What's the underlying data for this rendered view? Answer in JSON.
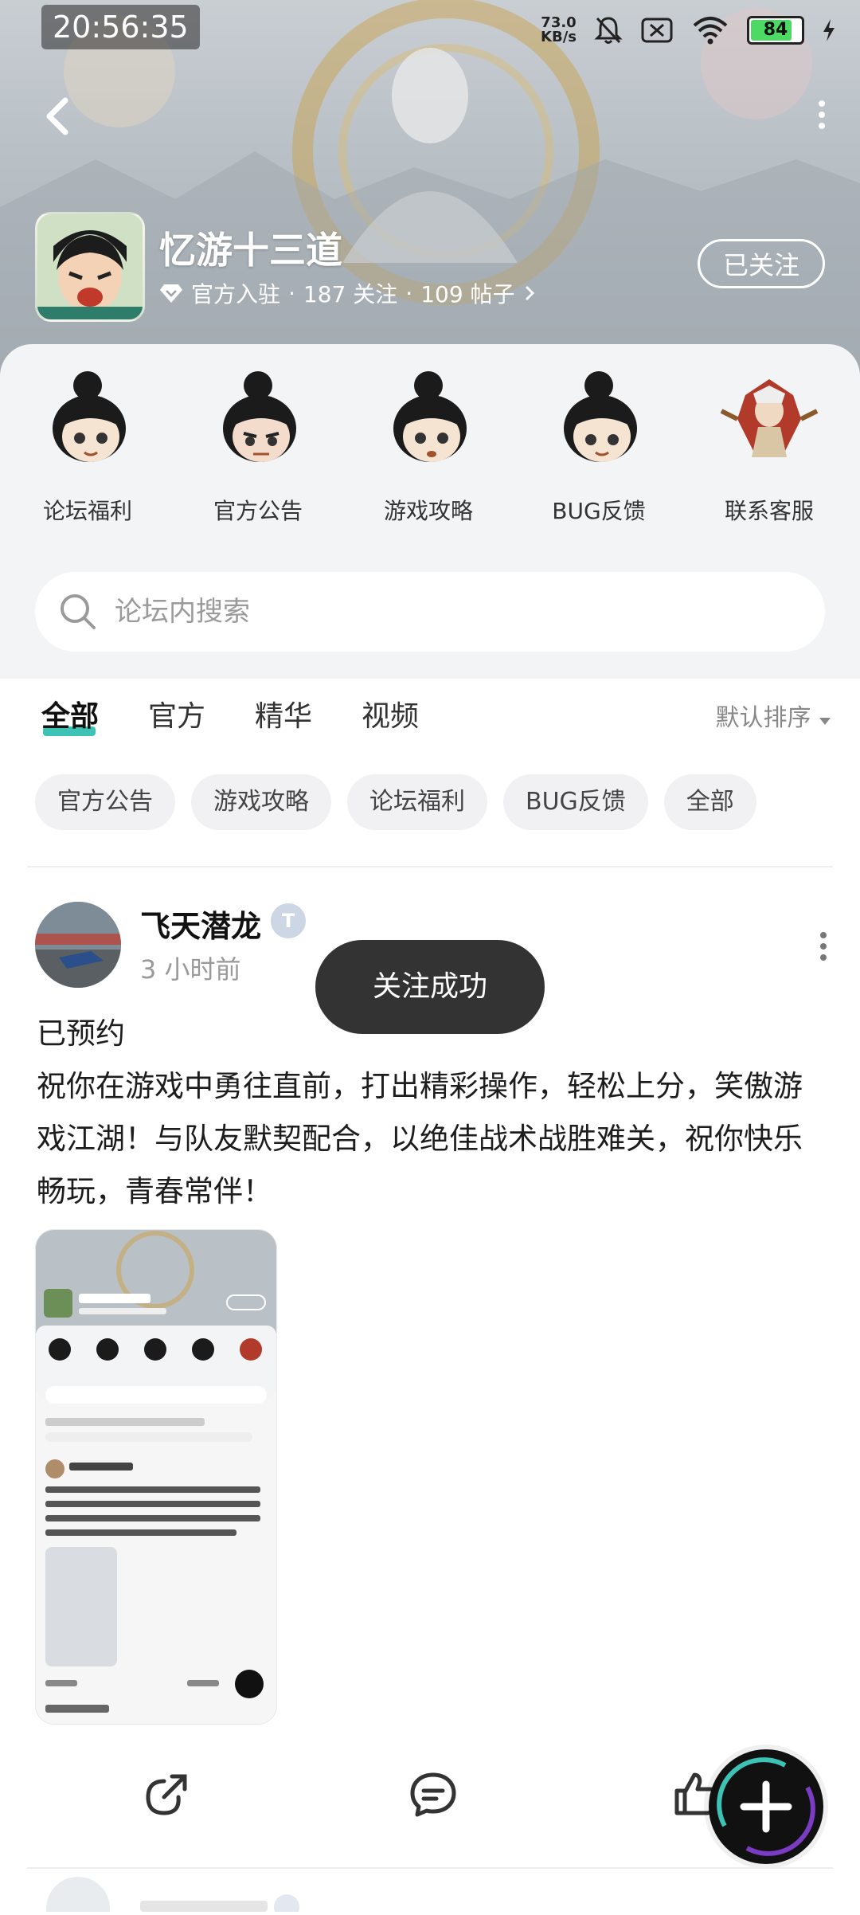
{
  "status_bar": {
    "time": "20:56:35",
    "net_speed_value": "73.0",
    "net_speed_unit": "KB/s",
    "battery": "84",
    "battery_level": 0.84,
    "icons": [
      "bell-muted-icon",
      "sim-off-icon",
      "wifi-icon",
      "battery-icon",
      "charging-icon"
    ]
  },
  "header": {
    "back_icon": "back-arrow-icon",
    "more_icon": "more-vertical-icon",
    "forum_name": "忆游十三道",
    "verified_label": "官方入驻",
    "following_count": "187 关注",
    "post_count": "109 帖子",
    "separator": "·",
    "follow_button": "已关注"
  },
  "shortcuts": [
    {
      "label": "论坛福利",
      "icon": "character-avatar-icon"
    },
    {
      "label": "官方公告",
      "icon": "character-avatar-icon"
    },
    {
      "label": "游戏攻略",
      "icon": "character-avatar-icon"
    },
    {
      "label": "BUG反馈",
      "icon": "character-avatar-icon"
    },
    {
      "label": "联系客服",
      "icon": "warrior-avatar-icon"
    }
  ],
  "search": {
    "placeholder": "论坛内搜索"
  },
  "tabs": [
    {
      "label": "全部",
      "active": true
    },
    {
      "label": "官方",
      "active": false
    },
    {
      "label": "精华",
      "active": false
    },
    {
      "label": "视频",
      "active": false
    }
  ],
  "sort_label": "默认排序",
  "chips": [
    "官方公告",
    "游戏攻略",
    "论坛福利",
    "BUG反馈",
    "全部"
  ],
  "post": {
    "author": "飞天潜龙",
    "level": "T",
    "time": "3 小时前",
    "body_line1": "已预约",
    "body_line2": "祝你在游戏中勇往直前，打出精彩操作，轻松上分，笑傲游戏江湖！与队友默契配合，以绝佳战术战胜难关，祝你快乐畅玩，青春常伴！"
  },
  "toast": "关注成功",
  "actions": [
    "share-icon",
    "comment-icon",
    "like-icon"
  ],
  "fab_icon": "plus-icon",
  "colors": {
    "accent": "#3cc3b6",
    "toast_bg": "#333333",
    "panel_bg": "#f3f4f6"
  }
}
